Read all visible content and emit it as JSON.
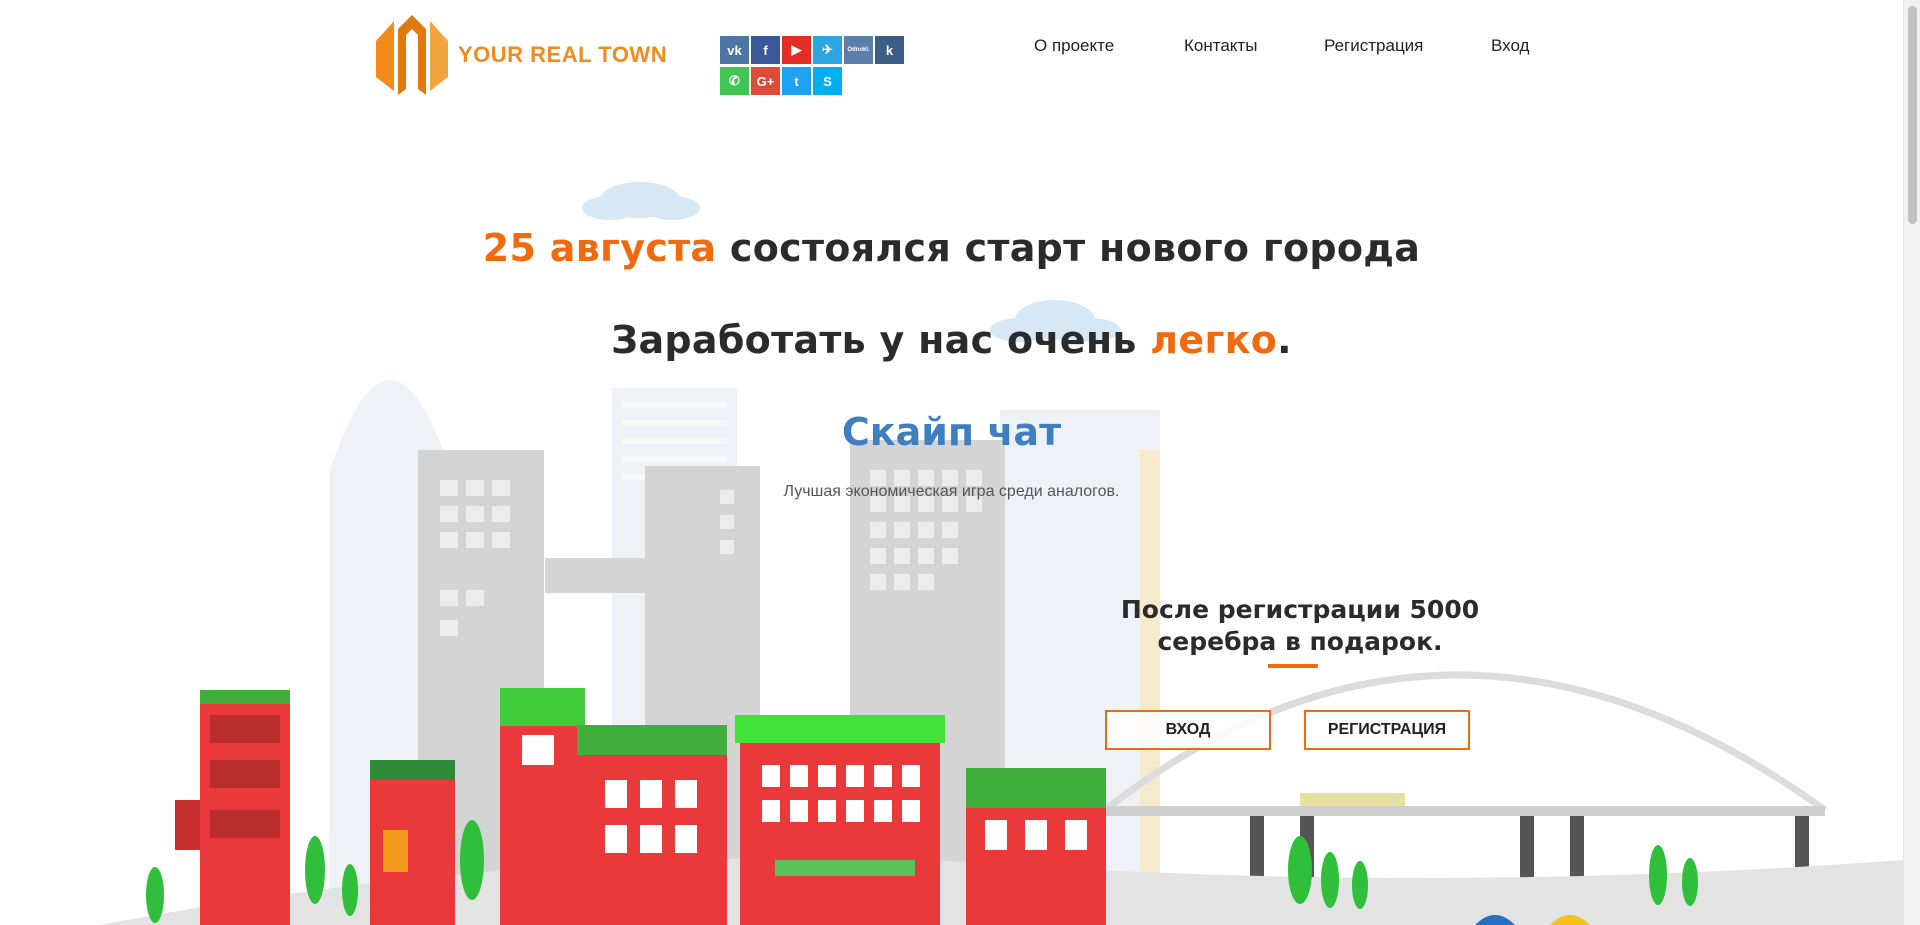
{
  "header": {
    "logo_text": "YOUR REAL TOWN",
    "social": [
      {
        "name": "vk",
        "label": "vk",
        "color": "#4c75a3"
      },
      {
        "name": "facebook",
        "label": "f",
        "color": "#3b5998"
      },
      {
        "name": "youtube",
        "label": "▶",
        "color": "#e52d27"
      },
      {
        "name": "telegram",
        "label": "✈",
        "color": "#2ca5e0"
      },
      {
        "name": "odnoklassniki",
        "label": "Odnokl.",
        "color": "#5b7fa8"
      },
      {
        "name": "k",
        "label": "k",
        "color": "#3a5e86"
      },
      {
        "name": "whatsapp",
        "label": "✆",
        "color": "#43c553"
      },
      {
        "name": "googleplus",
        "label": "G+",
        "color": "#dd4b39"
      },
      {
        "name": "twitter",
        "label": "t",
        "color": "#1da1f2"
      },
      {
        "name": "skype",
        "label": "S",
        "color": "#00aff0"
      }
    ],
    "nav": [
      "О проекте",
      "Контакты",
      "Регистрация",
      "Вход"
    ]
  },
  "hero": {
    "line1_accent": "25 августа",
    "line1_rest": " состоялся старт нового города",
    "line2_start": "Заработать у нас очень ",
    "line2_accent": "легко",
    "line2_end": ".",
    "skype_chat": "Скайп чат",
    "tagline": "Лучшая экономическая игра среди аналогов."
  },
  "promo": {
    "text": "После регистрации 5000 серебра в подарок.",
    "login_button": "ВХОД",
    "register_button": "РЕГИСТРАЦИЯ"
  },
  "colors": {
    "accent": "#f26a0e",
    "logo": "#f28a1c",
    "link_blue": "#3d7fc1",
    "building_red": "#ef3b3b",
    "roof_green": "#45c93a"
  }
}
